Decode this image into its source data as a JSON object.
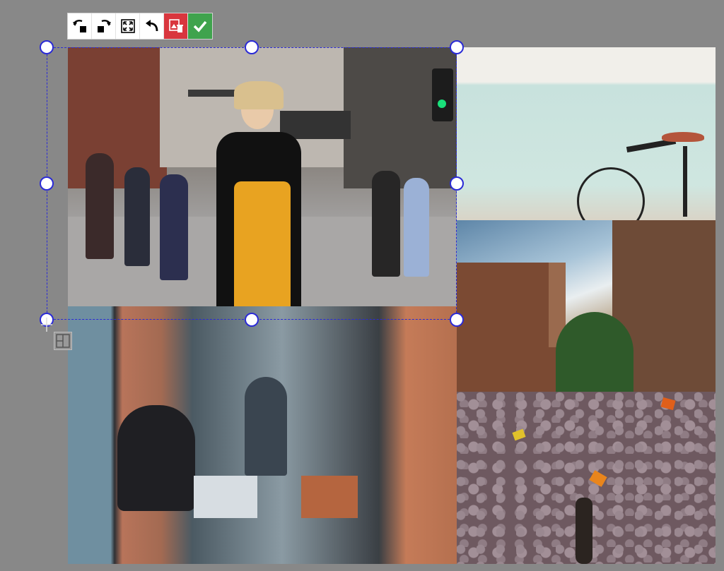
{
  "toolbar": {
    "buttons": [
      {
        "name": "rotate-left",
        "icon": "rotate-left-icon"
      },
      {
        "name": "rotate-right",
        "icon": "rotate-right-icon"
      },
      {
        "name": "fit",
        "icon": "fit-screen-icon"
      },
      {
        "name": "undo",
        "icon": "undo-icon"
      },
      {
        "name": "delete-image",
        "icon": "delete-image-icon",
        "color": "#d9363e"
      },
      {
        "name": "confirm",
        "icon": "checkmark-icon",
        "color": "#3fa34d"
      }
    ]
  },
  "selection": {
    "color": "#2a2ad6",
    "style": "dashed"
  },
  "collage": {
    "photos": [
      {
        "name": "street-woman-yellow-overalls",
        "selected": true
      },
      {
        "name": "bicycle-against-wall",
        "selected": false
      },
      {
        "name": "buildings-looking-up",
        "selected": false
      },
      {
        "name": "cobblestone-autumn-leaves",
        "selected": false
      },
      {
        "name": "cafe-window-laptop",
        "selected": false
      }
    ]
  },
  "layout_icon": "layout-grid-icon"
}
